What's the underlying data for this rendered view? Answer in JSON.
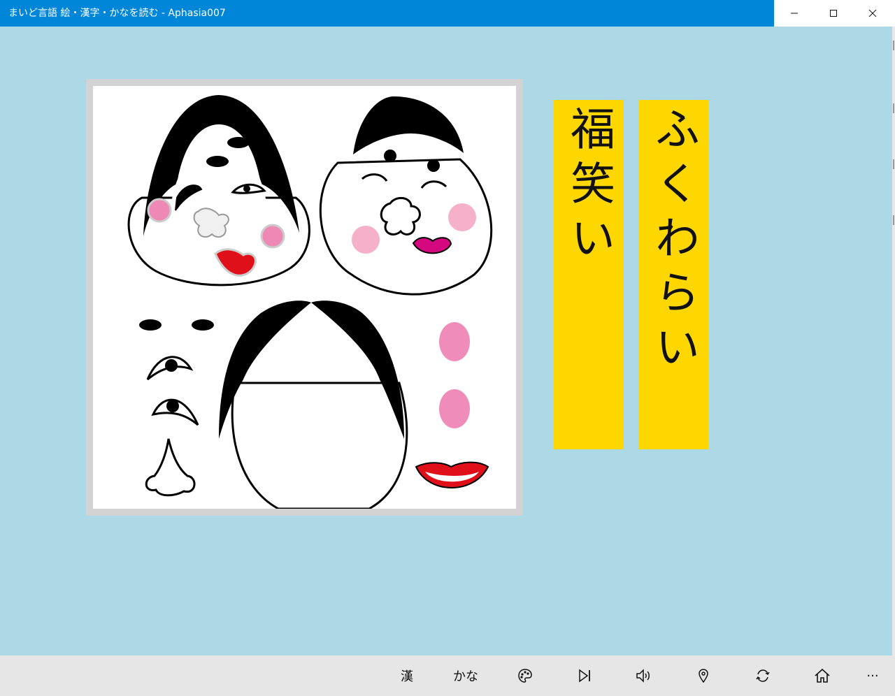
{
  "window": {
    "title": "まいど言語 絵・漢字・かなを読む - Aphasia007",
    "controls": {
      "minimize": "–",
      "maximize": "☐",
      "close": "✕"
    },
    "title_bar_color": "#0086d8"
  },
  "page": {
    "background": "#add8e6"
  },
  "picture": {
    "subject": "fukuwarai-okame-faces",
    "frame_color": "#d3d3d3"
  },
  "cards": {
    "color": "#ffd700",
    "kanji": "福笑い",
    "kana": "ふくわらい"
  },
  "appbar": {
    "kanji_label": "漢",
    "kana_label": "かな",
    "more_label": "···",
    "icons": [
      "palette-icon",
      "skip-next-icon",
      "speaker-icon",
      "map-pin-icon",
      "refresh-icon",
      "home-icon"
    ]
  }
}
